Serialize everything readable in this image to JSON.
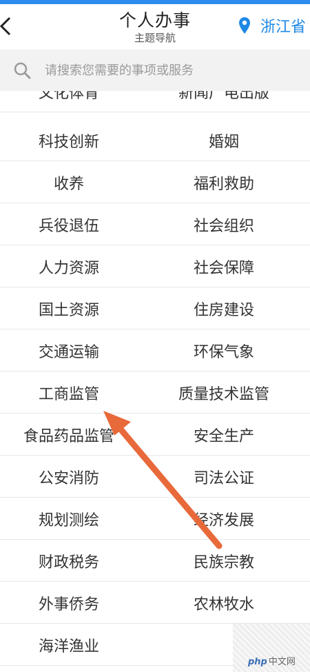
{
  "header": {
    "title": "个人办事",
    "subtitle": "主题导航",
    "location": "浙江省"
  },
  "search": {
    "placeholder": "请搜索您需要的事项或服务"
  },
  "categories": [
    [
      "文化体育",
      "新闻广电出版"
    ],
    [
      "科技创新",
      "婚姻"
    ],
    [
      "收养",
      "福利救助"
    ],
    [
      "兵役退伍",
      "社会组织"
    ],
    [
      "人力资源",
      "社会保障"
    ],
    [
      "国土资源",
      "住房建设"
    ],
    [
      "交通运输",
      "环保气象"
    ],
    [
      "工商监管",
      "质量技术监管"
    ],
    [
      "食品药品监管",
      "安全生产"
    ],
    [
      "公安消防",
      "司法公证"
    ],
    [
      "规划测绘",
      "经济发展"
    ],
    [
      "财政税务",
      "民族宗教"
    ],
    [
      "外事侨务",
      "农林牧水"
    ],
    [
      "海洋渔业",
      ""
    ]
  ],
  "watermark": {
    "brand": "php",
    "text": "中文网"
  },
  "colors": {
    "accent": "#1e88e5",
    "annotation_arrow": "#e8693a"
  }
}
